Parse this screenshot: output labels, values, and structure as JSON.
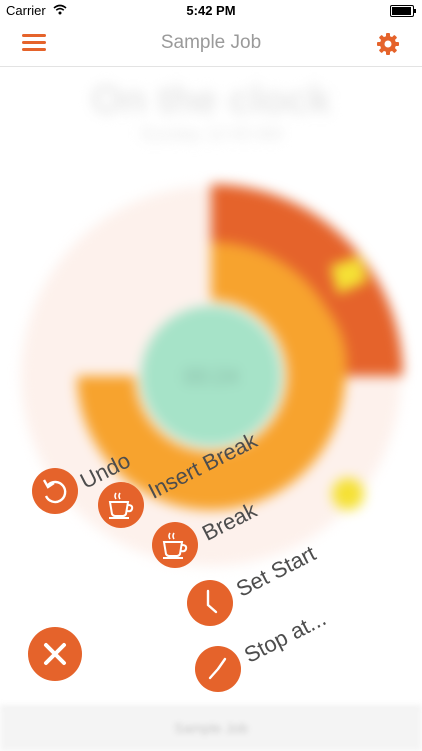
{
  "status_bar": {
    "carrier": "Carrier",
    "time": "5:42 PM"
  },
  "nav": {
    "title": "Sample Job"
  },
  "chart": {
    "heading": "On the clock",
    "subheading": "Sunday 12:45 AM",
    "center_value": "00:24"
  },
  "actions": [
    {
      "label": "Undo",
      "icon": "undo-icon"
    },
    {
      "label": "Insert Break",
      "icon": "coffee-cup-icon"
    },
    {
      "label": "Break",
      "icon": "coffee-cup-icon"
    },
    {
      "label": "Set Start",
      "icon": "clock-icon"
    },
    {
      "label": "Stop at...",
      "icon": "clock-icon"
    }
  ],
  "tab_bar": {
    "center_label": "Sample Job"
  },
  "colors": {
    "accent": "#e5632b",
    "orange": "#f7a32e",
    "mint": "#a6e3c8",
    "yellow": "#f5e135"
  }
}
